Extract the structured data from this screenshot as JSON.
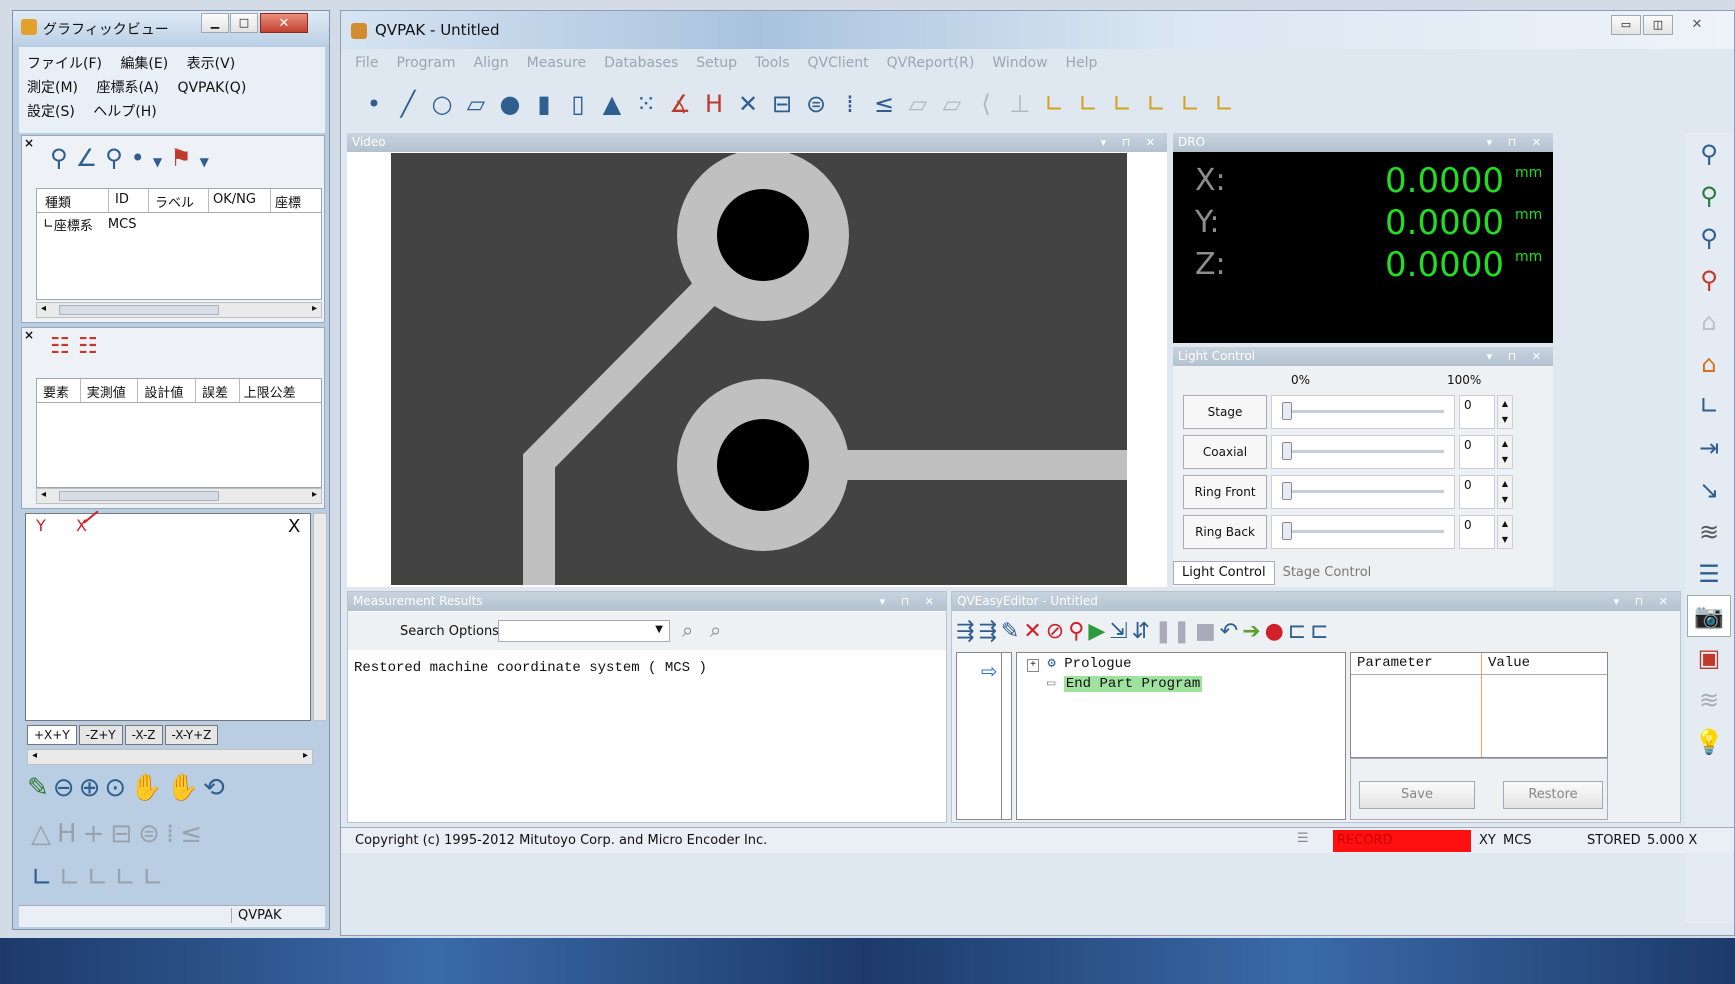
{
  "left_window": {
    "title": "グラフィックビュー",
    "menu_row1": [
      "ファイル(F)",
      "編集(E)",
      "表示(V)"
    ],
    "menu_row2": [
      "測定(M)",
      "座標系(A)",
      "QVPAK(Q)"
    ],
    "menu_row3": [
      "設定(S)",
      "ヘルプ(H)"
    ],
    "feature_table": {
      "headers": [
        "種類",
        "ID",
        "ラベル",
        "OK/NG",
        "座標"
      ],
      "row": {
        "type": "座標系",
        "id": "MCS"
      }
    },
    "result_table": {
      "headers": [
        "要素",
        "実測値",
        "設計値",
        "誤差",
        "上限公差"
      ]
    },
    "graphic": {
      "y_label": "Y",
      "x_label": "X",
      "x_label_right": "X"
    },
    "view_tabs": [
      "+X+Y",
      "-Z+Y",
      "-X-Z",
      "-X-Y+Z"
    ],
    "status": "QVPAK"
  },
  "main_window": {
    "title": "QVPAK - Untitled",
    "menu": [
      "File",
      "Program",
      "Align",
      "Measure",
      "Databases",
      "Setup",
      "Tools",
      "QVClient",
      "QVReport(R)",
      "Window",
      "Help"
    ]
  },
  "video": {
    "title": "Video",
    "colors": {
      "bg": "#434343",
      "pad": "#c0c0c0",
      "hole": "#000000"
    }
  },
  "dro": {
    "title": "DRO",
    "axes": [
      {
        "label": "X:",
        "value": "0.0000",
        "unit": "mm"
      },
      {
        "label": "Y:",
        "value": "0.0000",
        "unit": "mm"
      },
      {
        "label": "Z:",
        "value": "0.0000",
        "unit": "mm"
      }
    ],
    "value_color": "#22dd22"
  },
  "light_control": {
    "title": "Light Control",
    "min_label": "0%",
    "max_label": "100%",
    "rows": [
      {
        "name": "Stage",
        "value": "0",
        "level": 0
      },
      {
        "name": "Coaxial",
        "value": "0",
        "level": 0
      },
      {
        "name": "Ring Front",
        "value": "0",
        "level": 0
      },
      {
        "name": "Ring Back",
        "value": "0",
        "level": 0
      }
    ],
    "tabs": [
      "Light Control",
      "Stage Control"
    ]
  },
  "measurement_results": {
    "title": "Measurement Results",
    "search_label": "Search Options:",
    "message": "Restored machine coordinate system ( MCS )"
  },
  "easy_editor": {
    "title": "QVEasyEditor - Untitled",
    "tree": [
      "Prologue",
      "End Part Program"
    ],
    "param_headers": [
      "Parameter",
      "Value"
    ],
    "save_label": "Save",
    "restore_label": "Restore"
  },
  "status_bar": {
    "copyright": "Copyright (c) 1995-2012 Mitutoyo Corp. and Micro Encoder Inc.",
    "record": "RECORD",
    "plane": "XY",
    "coord": "MCS",
    "stored": "STORED",
    "magnification": "5.000 X",
    "record_color": "#ff1010"
  }
}
